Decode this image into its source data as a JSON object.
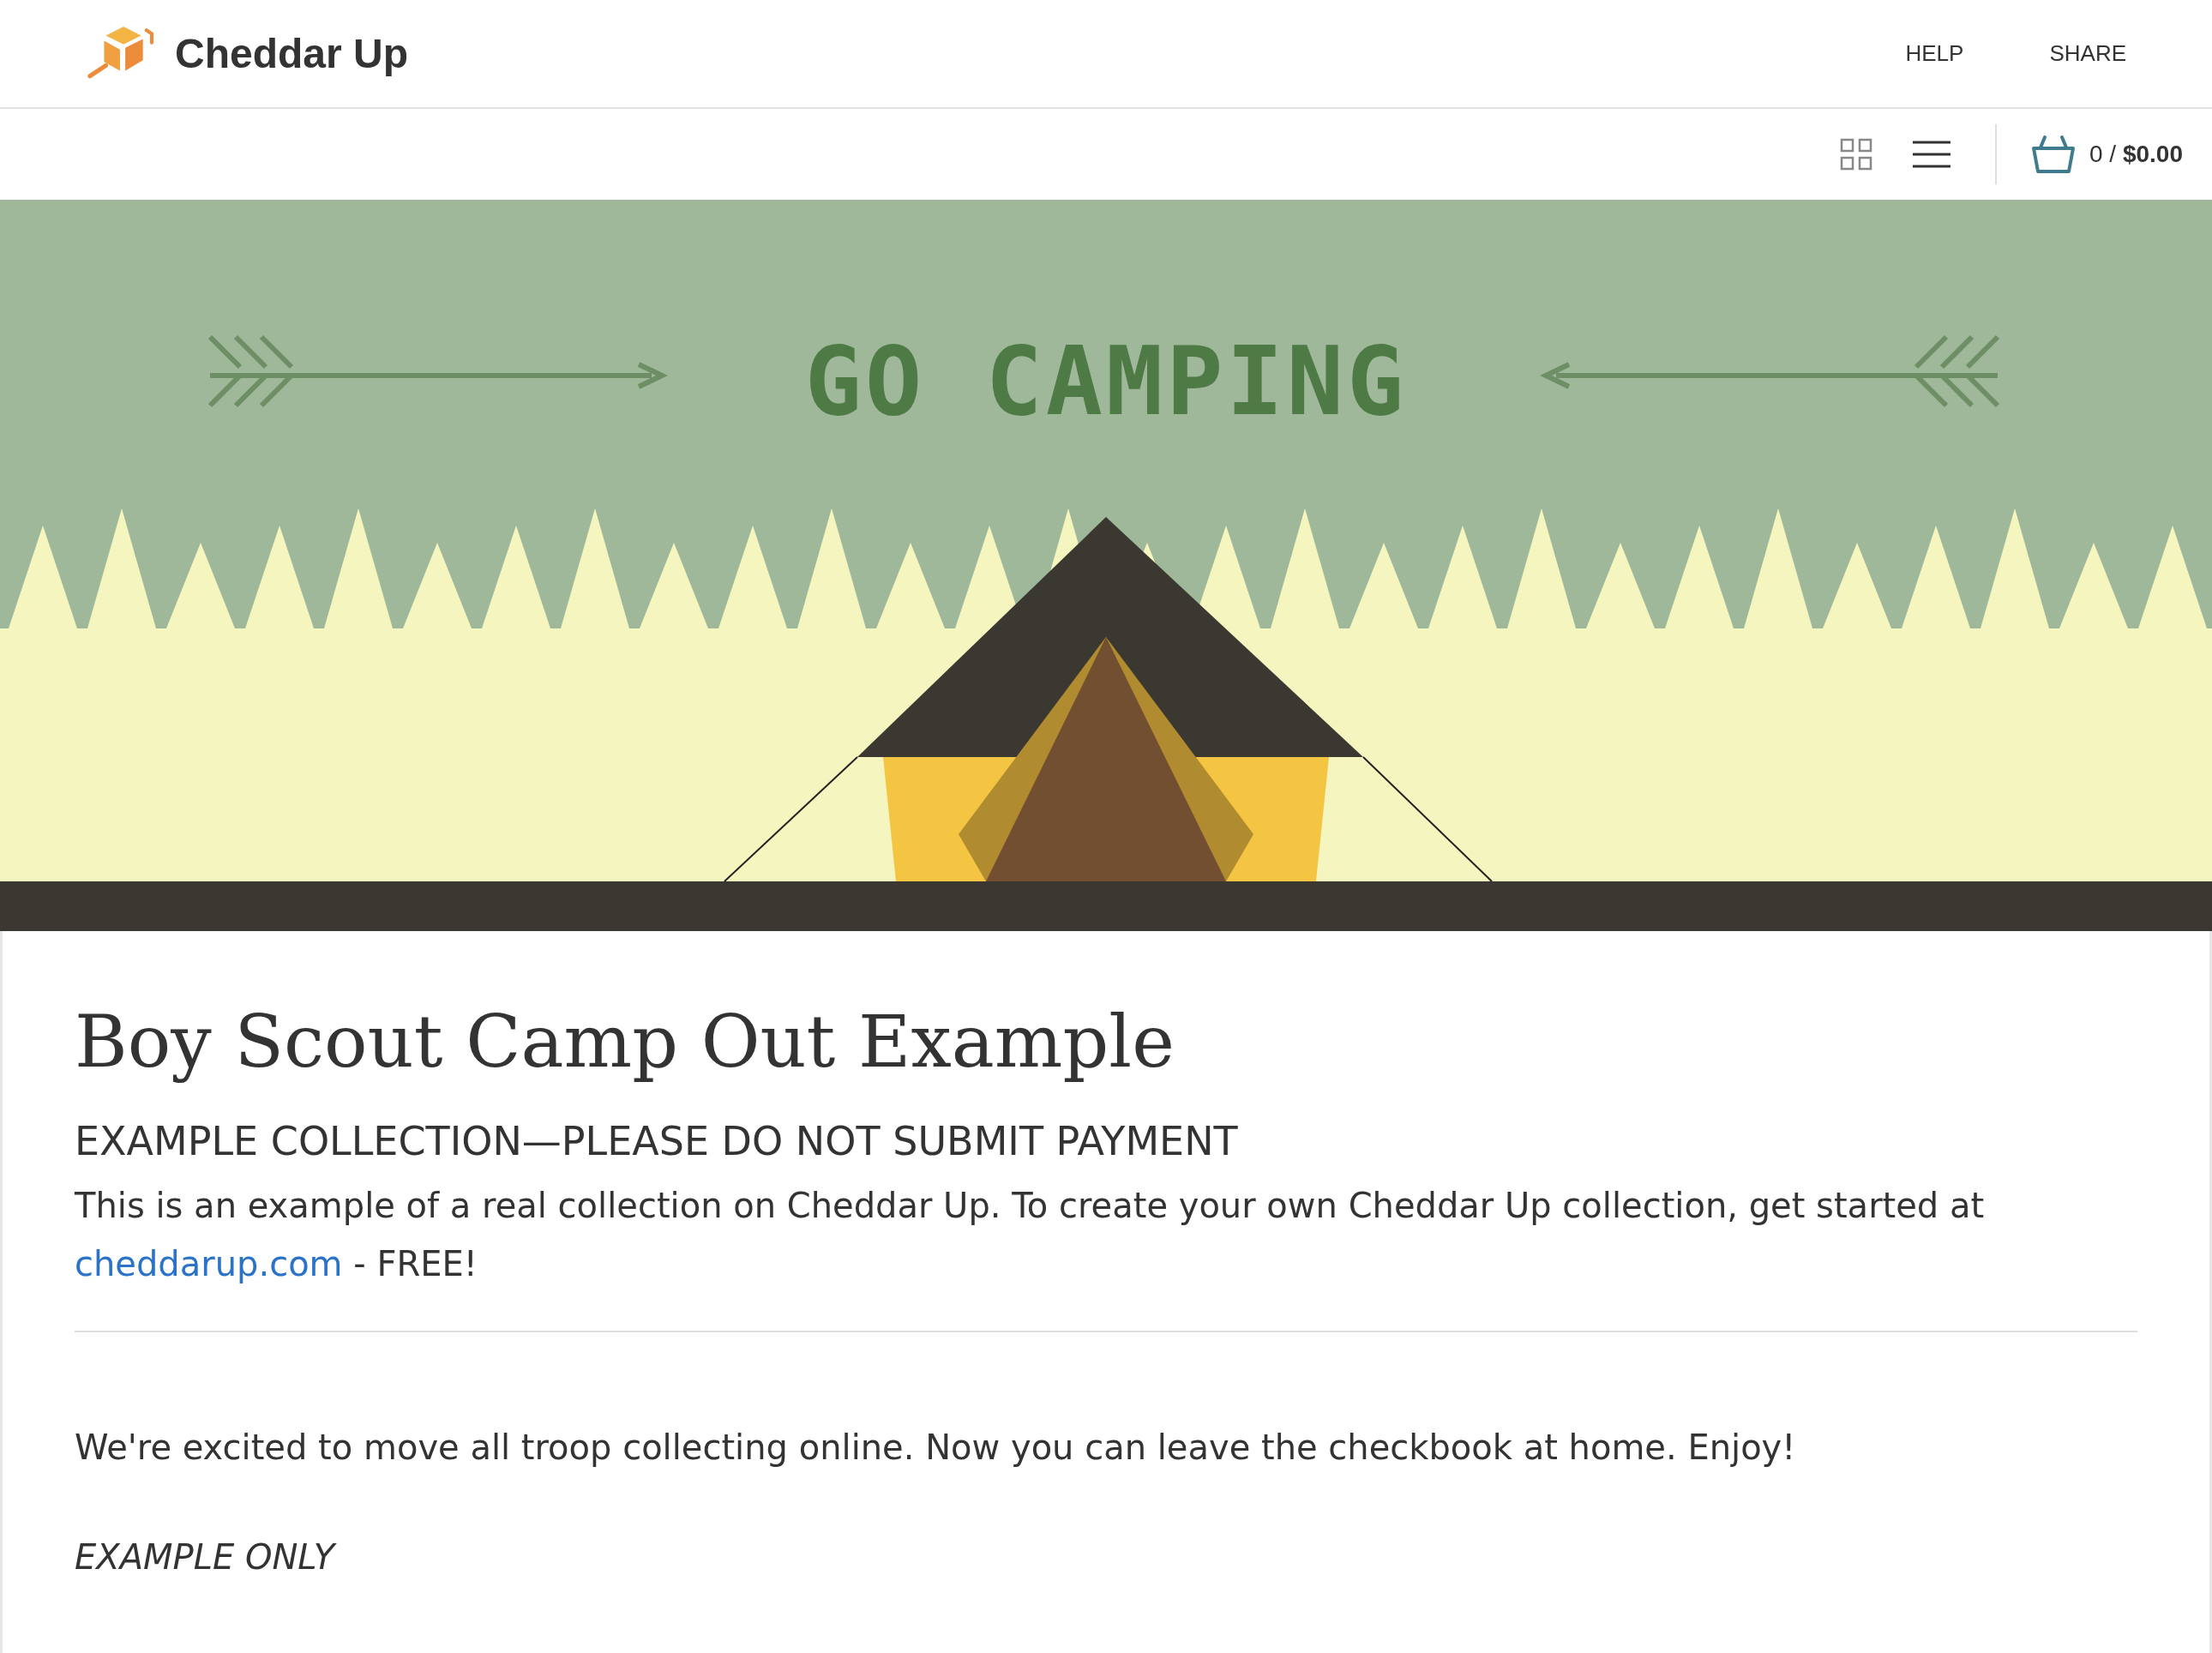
{
  "header": {
    "brand": "Cheddar Up",
    "nav": [
      "HELP",
      "SHARE"
    ]
  },
  "toolbar": {
    "cart": "0 / **$0.00**"
  },
  "banner": {
    "title": "GO CAMPING"
  },
  "collection": {
    "title": "Boy Scout Camp Out Example",
    "subtitle": "EXAMPLE COLLECTION—PLEASE DO NOT SUBMIT PAYMENT",
    "intro": "This is an example of a real collection on Cheddar Up. To create your own Cheddar Up collection, get started at",
    "link": "cheddarup.com",
    "link_suffix": " - FREE!",
    "description": "We're excited to move all troop collecting online. Now you can leave the checkbook at home. Enjoy!",
    "note": "EXAMPLE ONLY"
  }
}
